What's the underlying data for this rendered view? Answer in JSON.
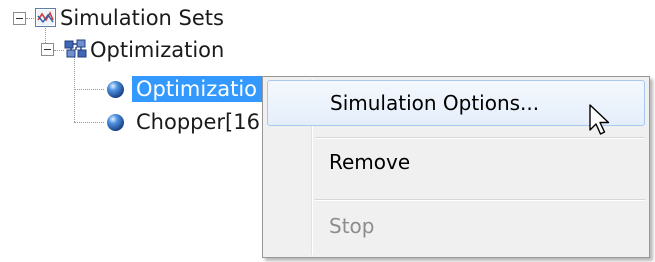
{
  "tree": {
    "root": {
      "label": "Simulation Sets",
      "icon": "scope-icon",
      "expanded": true
    },
    "group": {
      "label": "Optimization",
      "icon": "optimization-set-icon",
      "expanded": true
    },
    "items": [
      {
        "label": "Optimizatio",
        "icon": "blue-sphere-icon",
        "selected": true
      },
      {
        "label": "Chopper[16",
        "icon": "blue-sphere-icon",
        "selected": false
      }
    ]
  },
  "context_menu": {
    "items": [
      {
        "label": "Simulation Options...",
        "state": "hovered"
      },
      {
        "label": "Remove",
        "state": "enabled"
      },
      {
        "label": "Stop",
        "state": "disabled"
      }
    ]
  },
  "colors": {
    "selection": "#3399ff",
    "menu_background": "#f0f0f0",
    "menu_hover_border": "#a8c8ef",
    "disabled_text": "#8d8d8d"
  }
}
